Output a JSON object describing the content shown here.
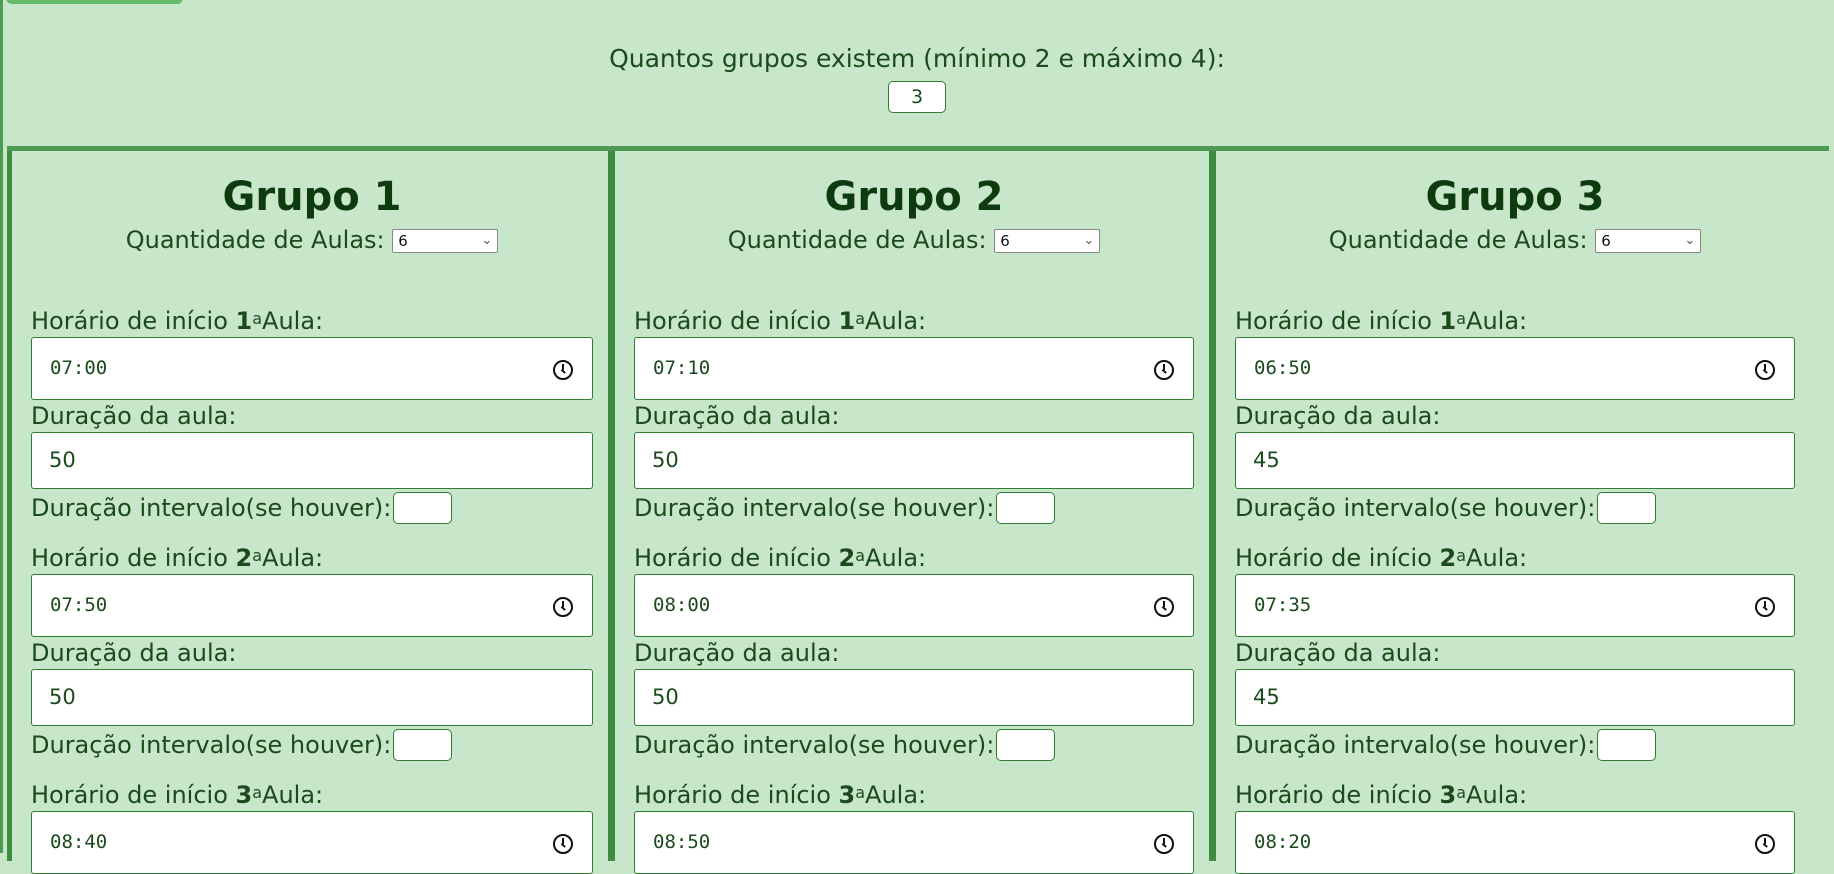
{
  "count": {
    "label": "Quantos grupos existem (mínimo 2 e máximo 4):",
    "value": "3"
  },
  "labels": {
    "qty": "Quantidade de Aulas:",
    "start_prefix": "Horário de início ",
    "ord": "a",
    "aula": "Aula:",
    "duration": "Duração da aula:",
    "interval": "Duração intervalo(se houver):"
  },
  "groups": [
    {
      "title": "Grupo 1",
      "qty": "6",
      "lessons": [
        {
          "n": "1",
          "start": "07:00",
          "duration": "50",
          "interval": ""
        },
        {
          "n": "2",
          "start": "07:50",
          "duration": "50",
          "interval": ""
        },
        {
          "n": "3",
          "start": "08:40"
        }
      ]
    },
    {
      "title": "Grupo 2",
      "qty": "6",
      "lessons": [
        {
          "n": "1",
          "start": "07:10",
          "duration": "50",
          "interval": ""
        },
        {
          "n": "2",
          "start": "08:00",
          "duration": "50",
          "interval": ""
        },
        {
          "n": "3",
          "start": "08:50"
        }
      ]
    },
    {
      "title": "Grupo 3",
      "qty": "6",
      "lessons": [
        {
          "n": "1",
          "start": "06:50",
          "duration": "45",
          "interval": ""
        },
        {
          "n": "2",
          "start": "07:35",
          "duration": "45",
          "interval": ""
        },
        {
          "n": "3",
          "start": "08:20"
        }
      ]
    }
  ]
}
